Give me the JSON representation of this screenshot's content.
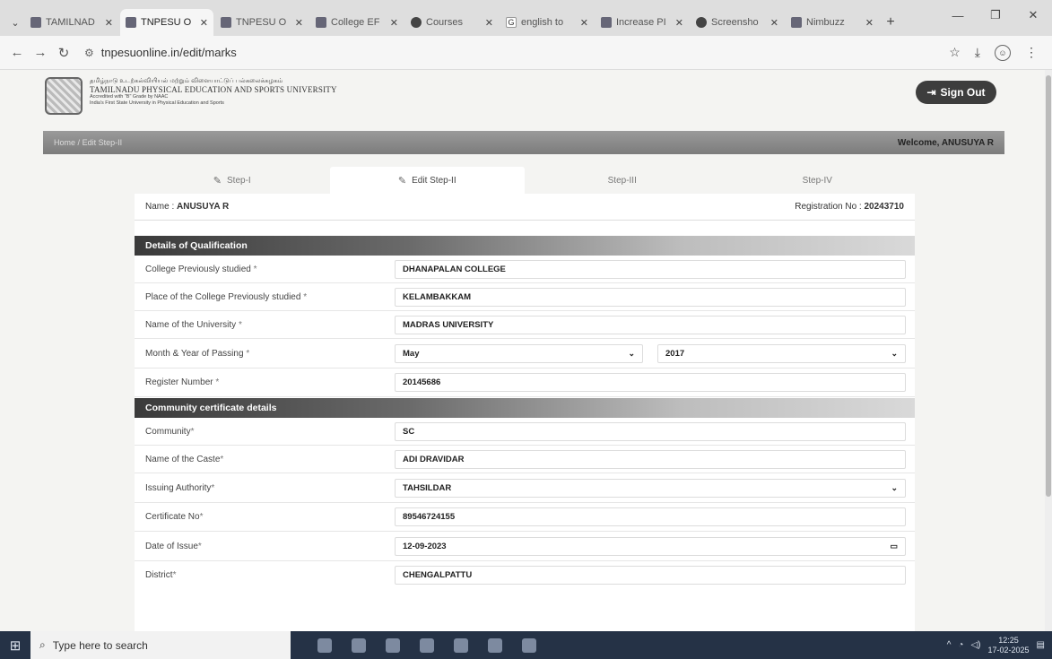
{
  "browser": {
    "tabs": [
      {
        "label": "TAMILNAD",
        "active": false
      },
      {
        "label": "TNPESU O",
        "active": true
      },
      {
        "label": "TNPESU O",
        "active": false
      },
      {
        "label": "College EF",
        "active": false
      },
      {
        "label": "Courses",
        "active": false
      },
      {
        "label": "english to",
        "active": false
      },
      {
        "label": "Increase PI",
        "active": false
      },
      {
        "label": "Screensho",
        "active": false
      },
      {
        "label": "Nimbuzz",
        "active": false
      }
    ],
    "url": "tnpesuonline.in/edit/marks"
  },
  "site": {
    "tamil_name": "தமிழ்நாடு உடற்கல்வியியல் மற்றும் விளையாட்டுப் பல்கலைக்கழகம்",
    "university_name": "TAMILNADU PHYSICAL EDUCATION AND SPORTS UNIVERSITY",
    "accreditation": "Accredited with \"B\" Grade by NAAC",
    "tagline": "India's First State University in Physical Education and Sports",
    "sign_out_label": "Sign Out"
  },
  "breadcrumb": {
    "home": "Home",
    "separator": "/",
    "current": "Edit Step-II",
    "welcome": "Welcome, ANUSUYA R"
  },
  "steps": [
    {
      "label": "Step-I",
      "active": false
    },
    {
      "label": "Edit Step-II",
      "active": true
    },
    {
      "label": "Step-III",
      "active": false
    },
    {
      "label": "Step-IV",
      "active": false
    }
  ],
  "applicant": {
    "name_label": "Name : ",
    "name": "ANUSUYA R",
    "reg_label": "Registration No : ",
    "reg_no": "20243710"
  },
  "qualification": {
    "title": "Details of Qualification",
    "college_label": "College Previously studied",
    "college": "DHANAPALAN COLLEGE",
    "place_label": "Place of the College Previously studied",
    "place": "KELAMBAKKAM",
    "university_label": "Name of the University",
    "university": "MADRAS UNIVERSITY",
    "passing_label": "Month & Year of Passing",
    "month": "May",
    "year": "2017",
    "regno_label": "Register Number",
    "regno": "20145686"
  },
  "community": {
    "title": "Community certificate details",
    "community_label": "Community",
    "community": "SC",
    "caste_label": "Name of the Caste",
    "caste": "ADI DRAVIDAR",
    "authority_label": "Issuing Authority",
    "authority": "TAHSILDAR",
    "cert_label": "Certificate No",
    "cert_no": "89546724155",
    "date_label": "Date of Issue",
    "date": "12-09-2023",
    "district_label": "District",
    "district": "CHENGALPATTU"
  },
  "taskbar": {
    "search_placeholder": "Type here to search",
    "time": "12:25",
    "date": "17-02-2025"
  }
}
